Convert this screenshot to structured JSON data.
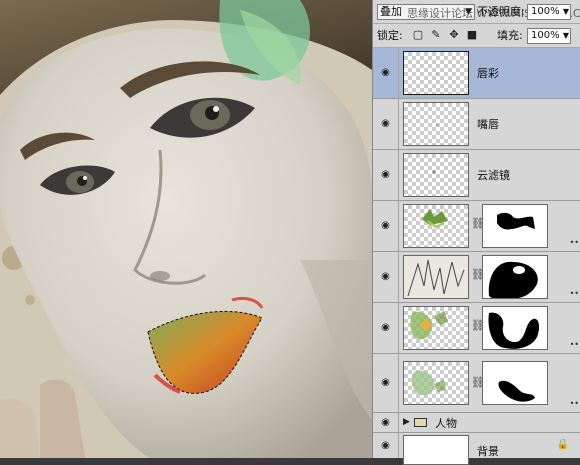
{
  "panel": {
    "blend_mode": "叠加",
    "watermark": "思缘设计论坛 WWW.MISSVUAN.COM",
    "opacity_label": "不透明度:",
    "opacity_value": "100%",
    "lock_label": "锁定:",
    "fill_label": "填充:",
    "fill_value": "100%",
    "lock_icons": [
      "lock-transparent-pixels-icon",
      "lock-image-pixels-icon",
      "lock-position-icon",
      "lock-all-icon"
    ],
    "layers": [
      {
        "name": "唇彩",
        "selected": true,
        "has_mask": false
      },
      {
        "name": "嘴唇",
        "selected": false,
        "has_mask": false
      },
      {
        "name": "云滤镜",
        "selected": false,
        "has_mask": false
      },
      {
        "name": "",
        "selected": false,
        "has_mask": true
      },
      {
        "name": "",
        "selected": false,
        "has_mask": true
      },
      {
        "name": "",
        "selected": false,
        "has_mask": true
      },
      {
        "name": "",
        "selected": false,
        "has_mask": true
      }
    ],
    "group": {
      "name": "人物"
    },
    "background_layer": {
      "name": "背景"
    }
  },
  "colors": {
    "selected_layer": "#a7b7d8",
    "panel_bg": "#d6d6d6"
  }
}
